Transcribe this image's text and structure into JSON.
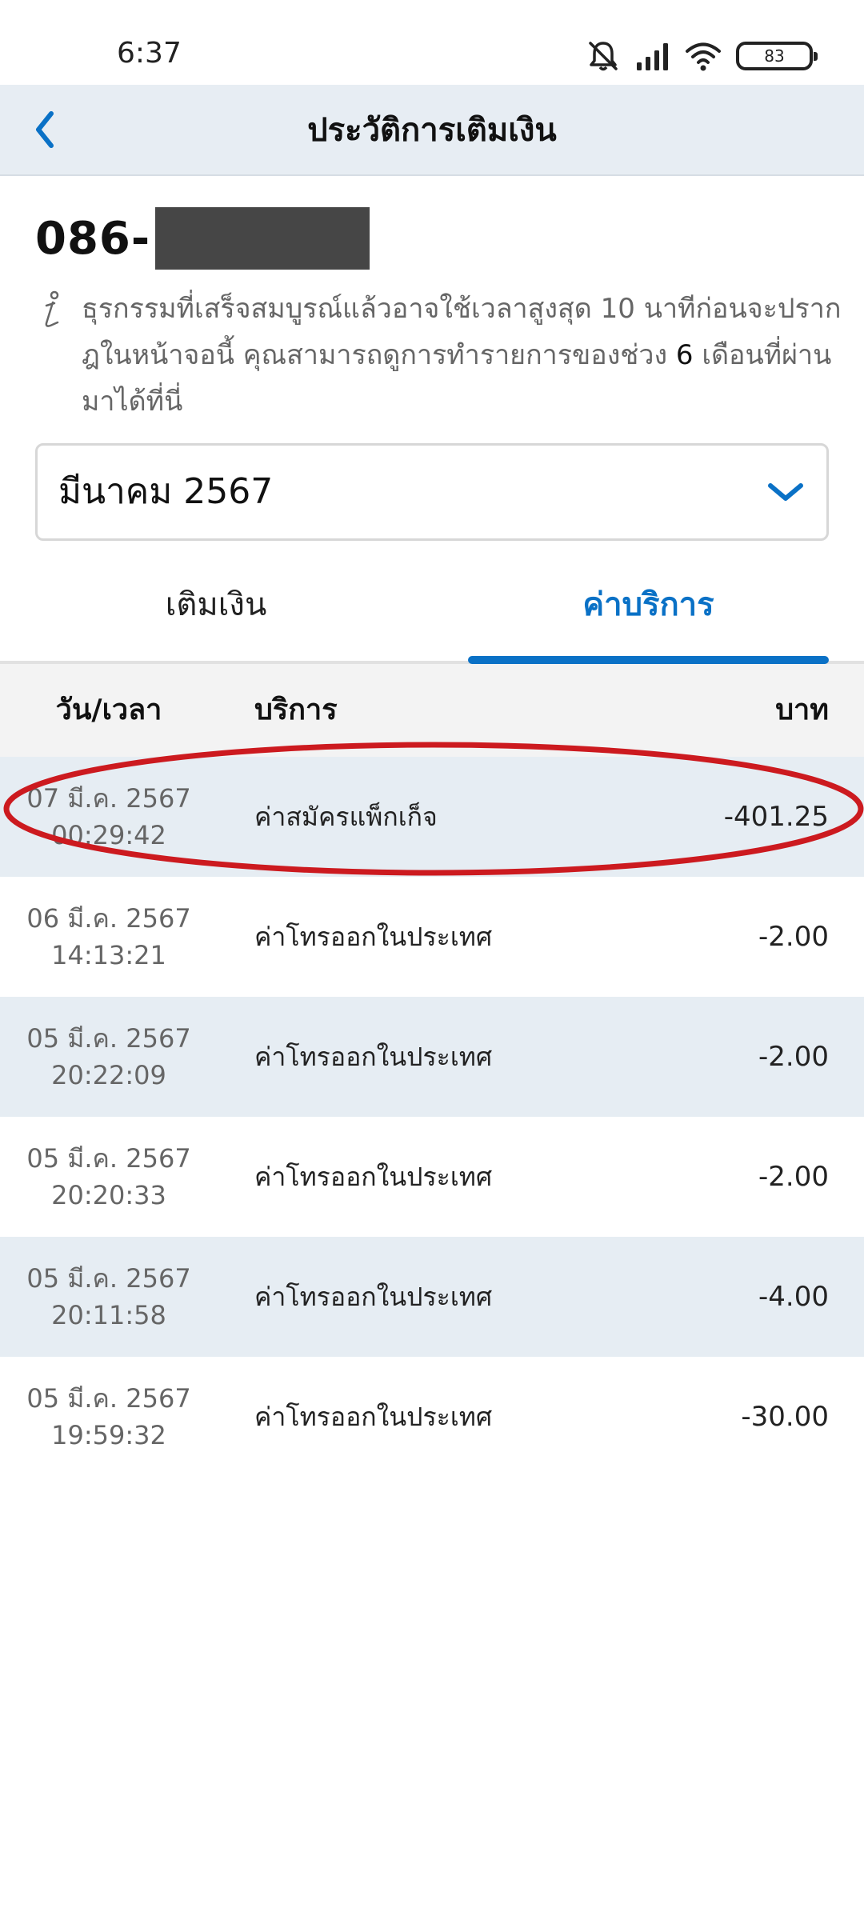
{
  "status_bar": {
    "time": "6:37",
    "battery": "83",
    "icons": [
      "bell-muted-icon",
      "signal-icon",
      "wifi-icon",
      "battery-icon"
    ]
  },
  "header": {
    "title": "ประวัติการเติมเงิน",
    "back_icon": "chevron-left-icon"
  },
  "account": {
    "phone_prefix": "086-"
  },
  "info": {
    "icon": "info-icon",
    "text": "ธุรกรรมที่เสร็จสมบูรณ์แล้วอาจใช้เวลาสูงสุด 10 นาทีก่อนจะปรากฎในหน้าจอนี้ คุณสามารถดูการทำรายการของช่วง ",
    "months": "6",
    "text_end": " เดือนที่ผ่านมาได้ที่นี่"
  },
  "month_select": {
    "value": "มีนาคม 2567",
    "icon": "chevron-down-icon"
  },
  "tabs": [
    {
      "label": "เติมเงิน",
      "active": false
    },
    {
      "label": "ค่าบริการ",
      "active": true
    }
  ],
  "table": {
    "columns": {
      "date": "วัน/เวลา",
      "service": "บริการ",
      "amount": "บาท"
    },
    "rows": [
      {
        "date": "07 มี.ค. 2567",
        "time": "00:29:42",
        "service": "ค่าสมัครแพ็กเก็จ",
        "amount": "-401.25"
      },
      {
        "date": "06 มี.ค. 2567",
        "time": "14:13:21",
        "service": "ค่าโทรออกในประเทศ",
        "amount": "-2.00"
      },
      {
        "date": "05 มี.ค. 2567",
        "time": "20:22:09",
        "service": "ค่าโทรออกในประเทศ",
        "amount": "-2.00"
      },
      {
        "date": "05 มี.ค. 2567",
        "time": "20:20:33",
        "service": "ค่าโทรออกในประเทศ",
        "amount": "-2.00"
      },
      {
        "date": "05 มี.ค. 2567",
        "time": "20:11:58",
        "service": "ค่าโทรออกในประเทศ",
        "amount": "-4.00"
      },
      {
        "date": "05 มี.ค. 2567",
        "time": "19:59:32",
        "service": "ค่าโทรออกในประเทศ",
        "amount": "-30.00"
      }
    ]
  },
  "colors": {
    "accent": "#0a71c6",
    "header_bg": "#e7edf3",
    "row_shaded": "#e6edf3",
    "highlight": "#cc1a1f"
  }
}
